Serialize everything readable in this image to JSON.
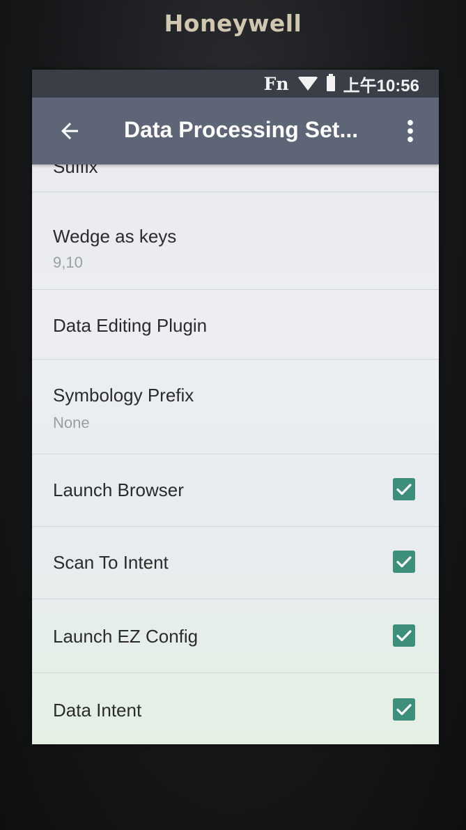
{
  "device": {
    "brand": "Honeywell"
  },
  "status_bar": {
    "fn_label": "Fn",
    "time": "上午10:56"
  },
  "app_bar": {
    "title": "Data Processing Set..."
  },
  "list": {
    "partial_item": {
      "label": "Suffix"
    },
    "items": [
      {
        "label": "Wedge as keys",
        "summary": "9,10"
      },
      {
        "label": "Data Editing Plugin"
      },
      {
        "label": "Symbology Prefix",
        "summary": "None"
      },
      {
        "label": "Launch Browser",
        "checked": true
      },
      {
        "label": "Scan To Intent",
        "checked": true
      },
      {
        "label": "Launch EZ Config",
        "checked": true
      },
      {
        "label": "Data Intent",
        "checked": true
      }
    ]
  },
  "colors": {
    "status_bar": "#3a3f47",
    "app_bar": "#5e6577",
    "checkbox": "#3d8f7c"
  }
}
